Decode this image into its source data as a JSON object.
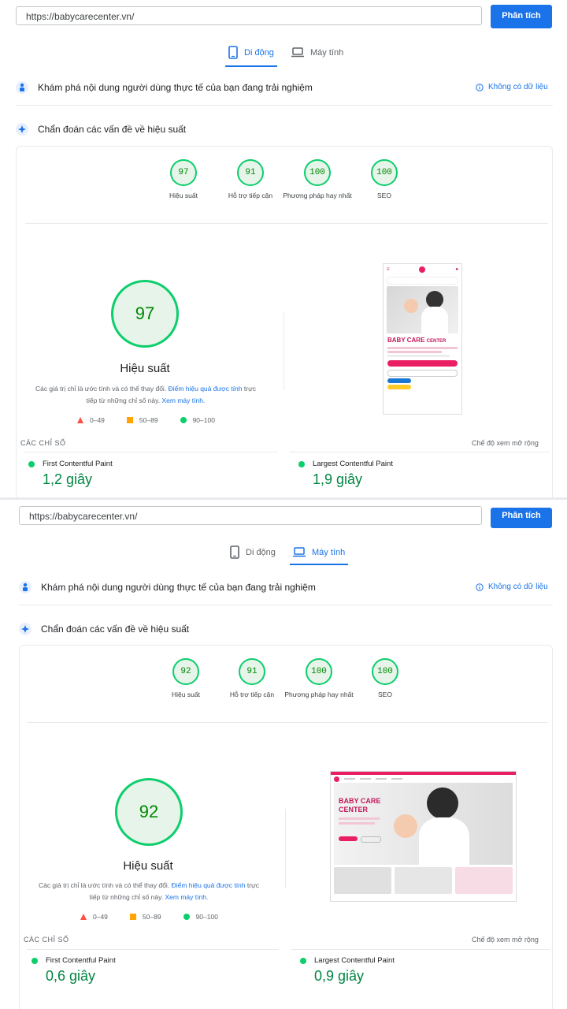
{
  "url": "https://babycarecenter.vn/",
  "analyze_label": "Phân tích",
  "tabs": {
    "mobile": "Di động",
    "desktop": "Máy tính"
  },
  "field_data_heading": "Khám phá nội dung người dùng thực tế của bạn đang trải nghiệm",
  "no_data_label": "Không có dữ liệu",
  "diagnose_heading": "Chẩn đoán các vấn đề về hiệu suất",
  "category_labels": {
    "performance": "Hiệu suất",
    "accessibility": "Hỗ trợ tiếp cận",
    "best_practices": "Phương pháp hay nhất",
    "seo": "SEO"
  },
  "note": {
    "text1": "Các giá trị chỉ là ước tính và có thể thay đổi.",
    "link1": "Điểm hiệu quả được tính",
    "text2": "trực tiếp từ những chỉ số này.",
    "link2": "Xem máy tính."
  },
  "legend": {
    "poor": "0–49",
    "average": "50–89",
    "good": "90–100"
  },
  "metrics_title": "CÁC CHỈ SỐ",
  "expand_label": "Chế độ xem mở rộng",
  "metric_names": {
    "fcp": "First Contentful Paint",
    "lcp": "Largest Contentful Paint"
  },
  "thumbnail_brand": {
    "line1": "BABY CARE",
    "line2": "CENTER"
  },
  "mobile": {
    "scores": {
      "performance": "97",
      "accessibility": "91",
      "best_practices": "100",
      "seo": "100"
    },
    "fcp": "1,2 giây",
    "lcp": "1,9 giây"
  },
  "desktop": {
    "scores": {
      "performance": "92",
      "accessibility": "91",
      "best_practices": "100",
      "seo": "100"
    },
    "fcp": "0,6 giây",
    "lcp": "0,9 giây"
  },
  "colors": {
    "good": "#0cce6b",
    "average": "#ffa400",
    "poor": "#ff4e42",
    "accent": "#1a73e8"
  }
}
